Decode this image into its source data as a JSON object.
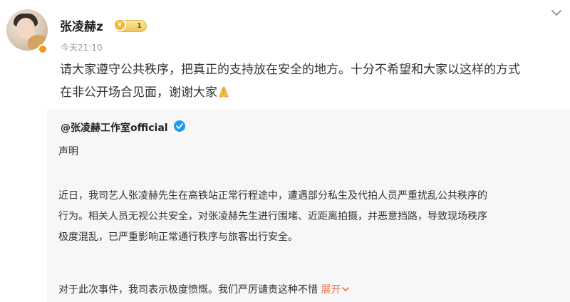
{
  "post": {
    "username": "张凌赫z",
    "badge_level": "1",
    "timestamp": "今天21:10",
    "text_line1": "请大家遵守公共秩序，把真正的支持放在安全的地方。十分不希望和大家以这样的方式",
    "text_line2": "在非公开场合见面，谢谢大家"
  },
  "repost": {
    "author": "@张凌赫工作室official",
    "heading": "声明",
    "para1_line1": "近日，我司艺人张凌赫先生在高铁站正常行程途中，遭遇部分私生及代拍人员严重扰乱公共秩序的",
    "para1_line2": "行为。相关人员无视公共安全，对张凌赫先生进行围堵、近距离拍摄，并恶意挡路，导致现场秩序",
    "para1_line3": "极度混乱，已严重影响正常通行秩序与旅客出行安全。",
    "para2": "对于此次事件，我司表示极度愤慨。我们严厉谴责这种不惜",
    "expand_label": "展开"
  },
  "icons": {
    "menu": "chevron-down-icon",
    "pray": "pray-emoji-icon",
    "verified": "verified-icon"
  },
  "colors": {
    "expand": "#eb7350",
    "verified": "#1e9bf0",
    "repost_bg": "#f7f7f7"
  }
}
